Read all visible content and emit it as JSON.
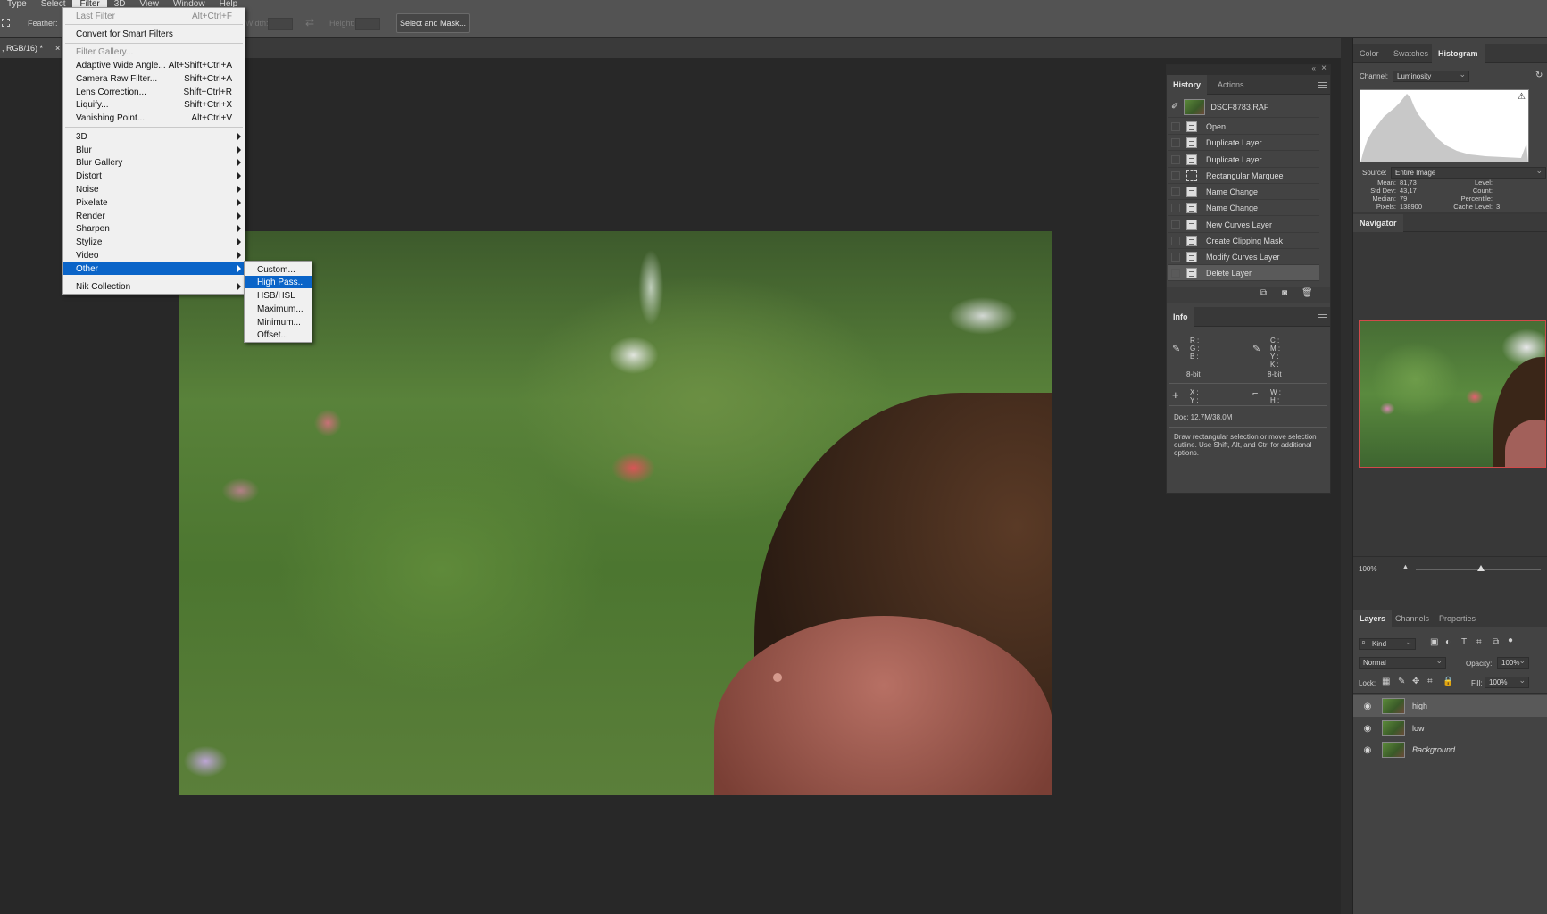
{
  "menubar": {
    "items": [
      "Type",
      "Select",
      "Filter",
      "3D",
      "View",
      "Window",
      "Help"
    ]
  },
  "options": {
    "feather_label": "Feather:",
    "width_label": "Width:",
    "height_label": "Height:",
    "select_and_mask": "Select and Mask..."
  },
  "document_tab": {
    "title": ", RGB/16) *",
    "close": "×"
  },
  "filter_menu": {
    "last_filter": {
      "label": "Last Filter",
      "shortcut": "Alt+Ctrl+F"
    },
    "convert_smart": "Convert for Smart Filters",
    "filter_gallery": "Filter Gallery...",
    "items_a": [
      {
        "label": "Adaptive Wide Angle...",
        "shortcut": "Alt+Shift+Ctrl+A"
      },
      {
        "label": "Camera Raw Filter...",
        "shortcut": "Shift+Ctrl+A"
      },
      {
        "label": "Lens Correction...",
        "shortcut": "Shift+Ctrl+R"
      },
      {
        "label": "Liquify...",
        "shortcut": "Shift+Ctrl+X"
      },
      {
        "label": "Vanishing Point...",
        "shortcut": "Alt+Ctrl+V"
      }
    ],
    "submenus": [
      "3D",
      "Blur",
      "Blur Gallery",
      "Distort",
      "Noise",
      "Pixelate",
      "Render",
      "Sharpen",
      "Stylize",
      "Video",
      "Other"
    ],
    "nik": "Nik Collection"
  },
  "other_submenu": {
    "items": [
      "Custom...",
      "High Pass...",
      "HSB/HSL",
      "Maximum...",
      "Minimum...",
      "Offset..."
    ]
  },
  "history_panel": {
    "tabs": [
      "History",
      "Actions"
    ],
    "snapshot": "DSCF8783.RAF",
    "steps": [
      "Open",
      "Duplicate Layer",
      "Duplicate Layer",
      "Rectangular Marquee",
      "Name Change",
      "Name Change",
      "New Curves Layer",
      "Create Clipping Mask",
      "Modify Curves Layer",
      "Delete Layer"
    ]
  },
  "info_panel": {
    "tab": "Info",
    "rgb": "R :\nG :\nB :",
    "cmyk": "C :\nM :\nY :\nK :",
    "bit_left": "8-bit",
    "bit_right": "8-bit",
    "xy": "X :\nY :",
    "wh": "W :\nH :",
    "doc": "Doc: 12,7M/38,0M",
    "hint": "Draw rectangular selection or move selection outline.  Use Shift, Alt, and Ctrl for additional options."
  },
  "right_tabs": {
    "items": [
      "Color",
      "Swatches",
      "Histogram"
    ]
  },
  "histogram": {
    "channel_label": "Channel:",
    "channel_value": "Luminosity",
    "source_label": "Source:",
    "source_value": "Entire Image",
    "left_stats": {
      "labels": "Mean:\nStd Dev:\nMedian:\nPixels:",
      "values": "81,73\n43,17\n79\n138900"
    },
    "right_stats": {
      "labels": "Level:\nCount:\nPercentile:\nCache Level:",
      "values": "\n\n\n3"
    }
  },
  "navigator": {
    "title": "Navigator",
    "zoom": "100%",
    "slider_fraction": 0.52
  },
  "layers_panel": {
    "tabs": [
      "Layers",
      "Channels",
      "Properties"
    ],
    "filter_kind": "Kind",
    "blend_mode": "Normal",
    "opacity_label": "Opacity:",
    "opacity_value": "100%",
    "lock_label": "Lock:",
    "fill_label": "Fill:",
    "fill_value": "100%",
    "layers": [
      {
        "name": "high",
        "selected": true
      },
      {
        "name": "low",
        "selected": false
      },
      {
        "name": "Background",
        "selected": false
      }
    ]
  }
}
